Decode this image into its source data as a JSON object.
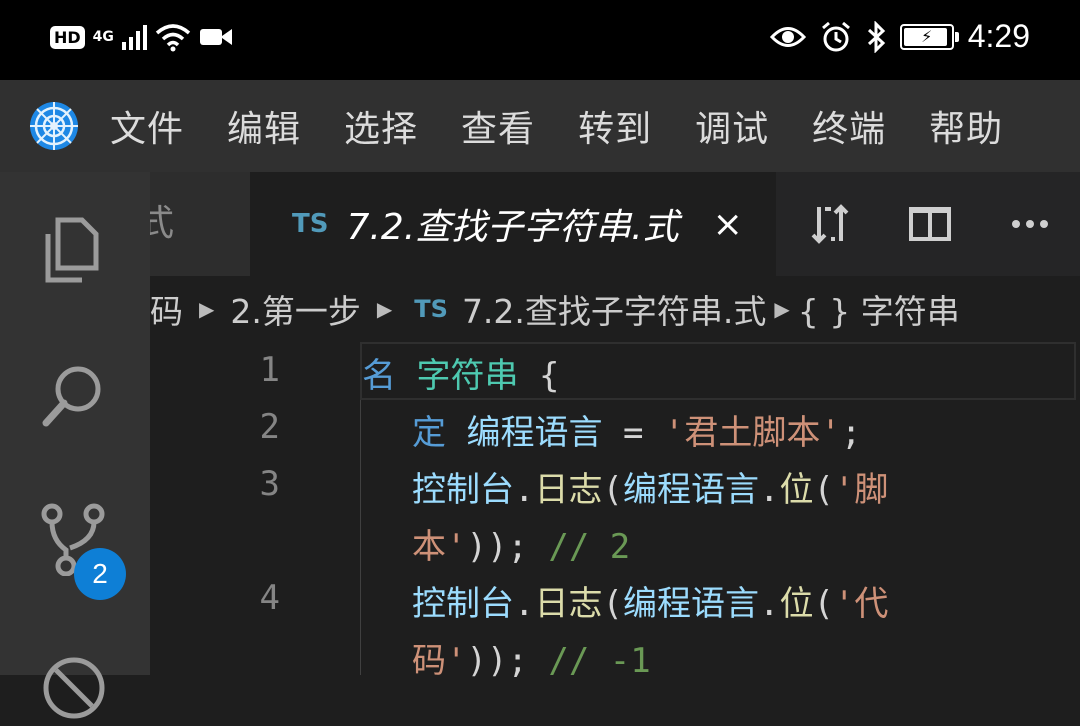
{
  "status_bar": {
    "hd": "HD",
    "network": "4G",
    "time": "4:29",
    "battery_level": 0.95,
    "icons": [
      "signal-icon",
      "wifi-icon",
      "video-icon",
      "eye-icon",
      "alarm-icon",
      "bluetooth-icon",
      "battery-icon"
    ]
  },
  "menu": {
    "items": [
      "文件",
      "编辑",
      "选择",
      "查看",
      "转到",
      "调试",
      "终端",
      "帮助"
    ]
  },
  "activity": {
    "source_control_badge": "2"
  },
  "tabs": {
    "prev_fragment": "式",
    "active": {
      "lang": "TS",
      "title": "7.2.查找子字符串.式",
      "close": "×"
    }
  },
  "breadcrumb": {
    "part1": "码",
    "part2": "2.第一步",
    "lang": "TS",
    "part3": "7.2.查找子字符串.式",
    "part4": "{ } 字符串"
  },
  "editor": {
    "line_numbers": [
      "1",
      "2",
      "3",
      "4"
    ],
    "line1": {
      "kw": "名",
      "type": "字符串",
      "brace": "{"
    },
    "line2": {
      "kw": "定",
      "var": "编程语言",
      "eq": "=",
      "str": "'君土脚本'",
      "semi": ";"
    },
    "line3a": {
      "obj": "控制台",
      "dot1": ".",
      "fn": "日志",
      "p1": "(",
      "var": "编程语言",
      "dot2": ".",
      "method": "位",
      "p2": "(",
      "str": "'脚"
    },
    "line3b": {
      "str": "本'",
      "close": "));",
      "comment": "// 2"
    },
    "line4a": {
      "obj": "控制台",
      "dot1": ".",
      "fn": "日志",
      "p1": "(",
      "var": "编程语言",
      "dot2": ".",
      "method": "位",
      "p2": "(",
      "str": "'代"
    },
    "line4b": {
      "str": "码'",
      "close": "));",
      "comment": "// -1"
    }
  },
  "colors": {
    "keyword": "#569cd6",
    "type": "#4ec9b0",
    "variable": "#9cdcfe",
    "string": "#ce9178",
    "comment": "#6a9955",
    "function": "#dcdcaa",
    "accent": "#0e7fd6"
  }
}
